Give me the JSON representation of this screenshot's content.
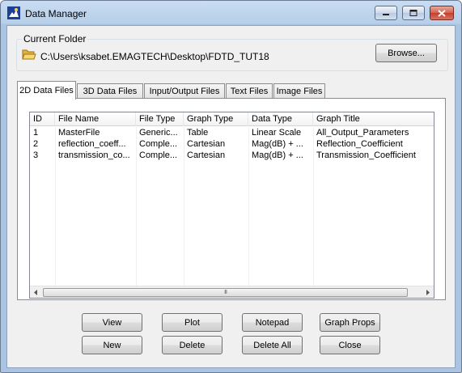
{
  "window": {
    "title": "Data Manager",
    "minimize_icon": "minimize-icon",
    "maximize_icon": "maximize-icon",
    "close_icon": "close-icon"
  },
  "folder": {
    "legend": "Current Folder",
    "path": "C:\\Users\\ksabet.EMAGTECH\\Desktop\\FDTD_TUT18",
    "browse_label": "Browse..."
  },
  "tabs": [
    {
      "label": "2D Data Files",
      "active": true
    },
    {
      "label": "3D Data Files",
      "active": false
    },
    {
      "label": "Input/Output Files",
      "active": false
    },
    {
      "label": "Text Files",
      "active": false
    },
    {
      "label": "Image Files",
      "active": false
    }
  ],
  "table": {
    "columns": [
      "ID",
      "File Name",
      "File Type",
      "Graph Type",
      "Data Type",
      "Graph Title"
    ],
    "rows": [
      [
        "1",
        "MasterFile",
        "Generic...",
        "Table",
        "Linear Scale",
        "All_Output_Parameters"
      ],
      [
        "2",
        "reflection_coeff...",
        "Comple...",
        "Cartesian",
        "Mag(dB) + ...",
        "Reflection_Coefficient"
      ],
      [
        "3",
        "transmission_co...",
        "Comple...",
        "Cartesian",
        "Mag(dB) + ...",
        "Transmission_Coefficient"
      ]
    ],
    "scroll_grip": "III"
  },
  "buttons": {
    "view": "View",
    "plot": "Plot",
    "notepad": "Notepad",
    "graph_props": "Graph Props",
    "new": "New",
    "delete": "Delete",
    "delete_all": "Delete All",
    "close": "Close"
  }
}
